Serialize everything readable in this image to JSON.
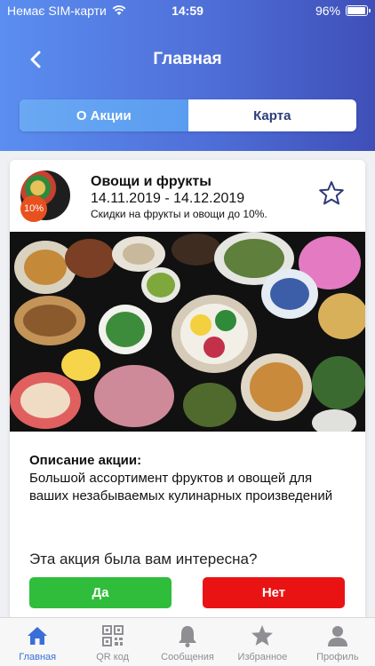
{
  "status": {
    "carrier": "Немає SIM-карти",
    "time": "14:59",
    "battery": "96%",
    "battery_level": 0.96
  },
  "nav": {
    "title": "Главная",
    "back_icon": "chevron-left-icon"
  },
  "segments": [
    {
      "label": "О Акции",
      "active": true
    },
    {
      "label": "Карта",
      "active": false
    }
  ],
  "promo": {
    "title": "Овощи и фрукты",
    "dates": "14.11.2019 - 14.12.2019",
    "subtitle": "Скидки на фрукты и овощи до 10%.",
    "badge": "10%",
    "favorite_icon": "star-outline-icon"
  },
  "description": {
    "label": "Описание акции:",
    "text": "Большой ассортимент фруктов и овощей для ваших незабываемых кулинарных произведений"
  },
  "feedback": {
    "question": "Эта акция была вам интересна?",
    "yes_label": "Да",
    "no_label": "Нет"
  },
  "tabbar": [
    {
      "label": "Главная",
      "icon": "home-icon",
      "active": true
    },
    {
      "label": "QR код",
      "icon": "qr-code-icon",
      "active": false
    },
    {
      "label": "Сообщения",
      "icon": "bell-icon",
      "active": false
    },
    {
      "label": "Избранное",
      "icon": "star-icon",
      "active": false
    },
    {
      "label": "Профиль",
      "icon": "user-icon",
      "active": false
    }
  ],
  "colors": {
    "header_start": "#5b8ef0",
    "header_end": "#3f4fb8",
    "yes": "#2fbd3b",
    "no": "#ea1313",
    "tab_active": "#3a6ed8",
    "tab_inactive": "#8e8e93"
  }
}
